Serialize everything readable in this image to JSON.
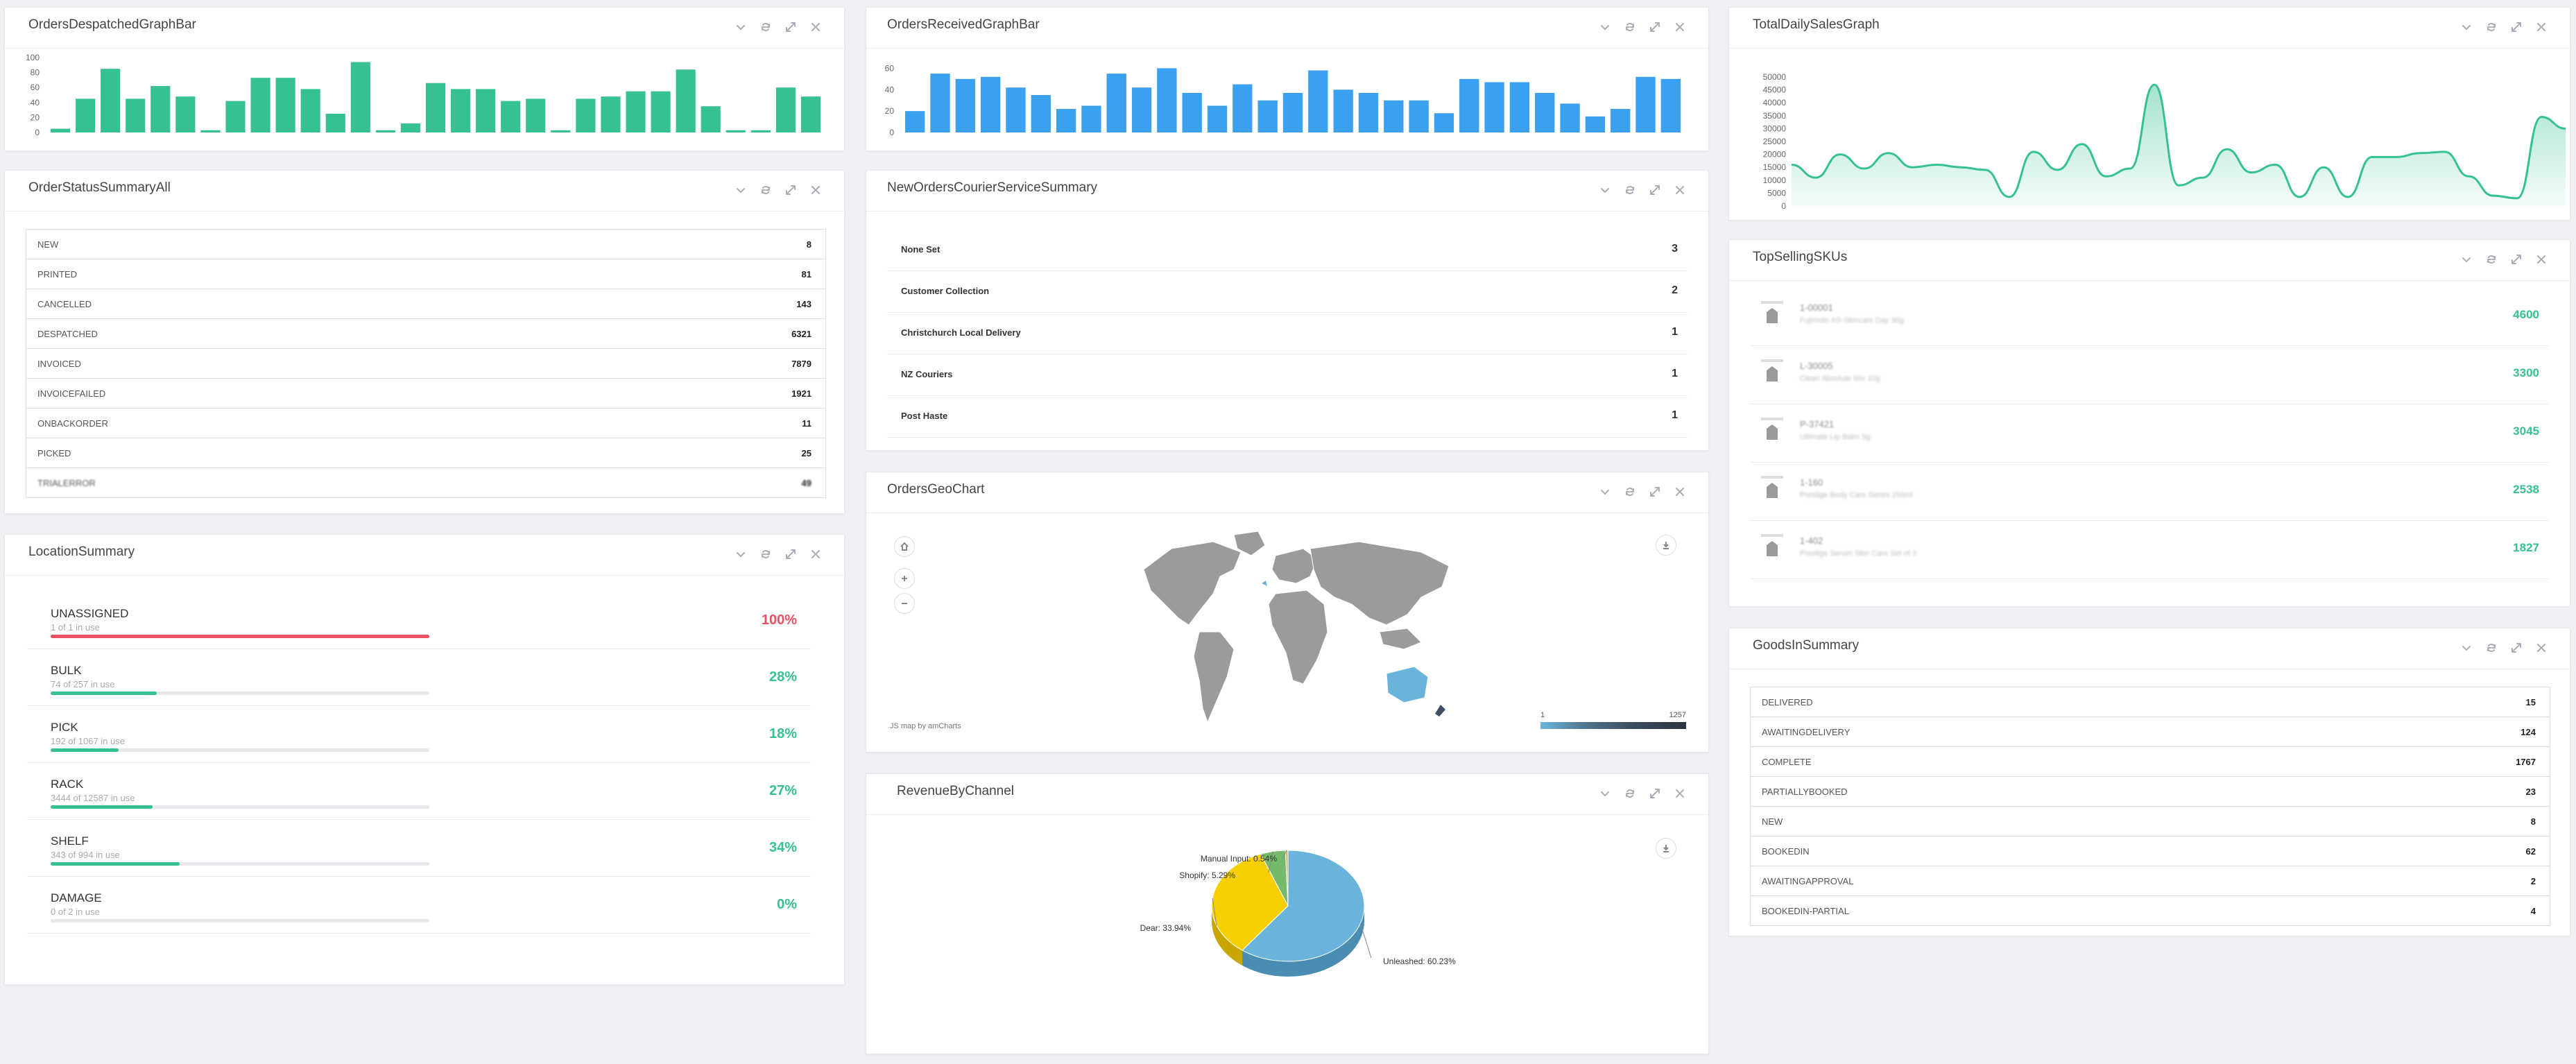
{
  "colors": {
    "teal": "#36c190",
    "blue": "#3aa0f0",
    "red": "#e8515f",
    "yellow": "#f8d000",
    "pieBlue": "#6ab4dc",
    "pieGreen": "#75b96b",
    "muted": "#9aa0aa"
  },
  "tool_icons": [
    "collapse-icon",
    "refresh-icon",
    "expand-icon",
    "close-icon"
  ],
  "despatched": {
    "title": "OrdersDespatchedGraphBar",
    "chart_data": {
      "type": "bar",
      "values": [
        5,
        45,
        85,
        45,
        62,
        48,
        3,
        42,
        73,
        73,
        58,
        25,
        94,
        3,
        12,
        66,
        58,
        58,
        42,
        45,
        3,
        45,
        48,
        55,
        55,
        84,
        35,
        3,
        3,
        60,
        48
      ],
      "ylim": [
        0,
        100
      ],
      "yticks": [
        "0",
        "20",
        "40",
        "60",
        "80",
        "100"
      ]
    }
  },
  "received": {
    "title": "OrdersReceivedGraphBar",
    "chart_data": {
      "type": "bar",
      "values": [
        20,
        55,
        50,
        52,
        42,
        35,
        22,
        25,
        55,
        42,
        60,
        37,
        25,
        45,
        30,
        37,
        58,
        40,
        37,
        30,
        30,
        18,
        50,
        47,
        47,
        37,
        27,
        15,
        22,
        52,
        50
      ],
      "ylim": [
        0,
        70
      ],
      "yticks": [
        "0",
        "20",
        "40",
        "60"
      ]
    }
  },
  "sales": {
    "title": "TotalDailySalesGraph",
    "chart_data": {
      "type": "area",
      "values": [
        16000,
        11000,
        20000,
        14500,
        20500,
        15000,
        16000,
        15000,
        14000,
        3500,
        21000,
        14000,
        24000,
        11500,
        14500,
        47000,
        8000,
        11000,
        22000,
        13000,
        16000,
        3500,
        15000,
        3500,
        19000,
        19000,
        20500,
        21000,
        11500,
        4000,
        3000,
        34500,
        30000
      ],
      "ylim": [
        0,
        50000
      ],
      "yticks": [
        "0",
        "5000",
        "10000",
        "15000",
        "20000",
        "25000",
        "30000",
        "35000",
        "40000",
        "45000",
        "50000"
      ]
    }
  },
  "orderStatus": {
    "title": "OrderStatusSummaryAll",
    "rows": [
      {
        "label": "NEW",
        "value": "8"
      },
      {
        "label": "PRINTED",
        "value": "81"
      },
      {
        "label": "CANCELLED",
        "value": "143"
      },
      {
        "label": "DESPATCHED",
        "value": "6321"
      },
      {
        "label": "INVOICED",
        "value": "7879"
      },
      {
        "label": "INVOICEFAILED",
        "value": "1921"
      },
      {
        "label": "ONBACKORDER",
        "value": "11"
      },
      {
        "label": "PICKED",
        "value": "25"
      },
      {
        "label": "TRIALERROR",
        "value": "49"
      }
    ]
  },
  "courier": {
    "title": "NewOrdersCourierServiceSummary",
    "rows": [
      {
        "label": "None Set",
        "value": "3"
      },
      {
        "label": "Customer Collection",
        "value": "2"
      },
      {
        "label": "Christchurch Local Delivery",
        "value": "1"
      },
      {
        "label": "NZ Couriers",
        "value": "1"
      },
      {
        "label": "Post Haste",
        "value": "1"
      }
    ]
  },
  "topSkus": {
    "title": "TopSellingSKUs",
    "rows": [
      {
        "code": "1-00001",
        "desc": "Fujimoto AS-Skincare Day 30g",
        "value": "4600"
      },
      {
        "code": "L-30005",
        "desc": "Clean Absolute Mix 10g",
        "value": "3300"
      },
      {
        "code": "P-37421",
        "desc": "Ultimate Lip Balm 5g",
        "value": "3045"
      },
      {
        "code": "1-160",
        "desc": "Prestige Body Care Series 250ml",
        "value": "2538"
      },
      {
        "code": "1-402",
        "desc": "Prestige Serum Skin Care Set of 3",
        "value": "1827"
      }
    ]
  },
  "location": {
    "title": "LocationSummary",
    "rows": [
      {
        "name": "UNASSIGNED",
        "sub": "1 of 1 in use",
        "pct": "100%",
        "fill": 1.0,
        "color": "#e8515f"
      },
      {
        "name": "BULK",
        "sub": "74 of 257 in use",
        "pct": "28%",
        "fill": 0.28,
        "color": "#36c190"
      },
      {
        "name": "PICK",
        "sub": "192 of 1067 in use",
        "pct": "18%",
        "fill": 0.18,
        "color": "#36c190"
      },
      {
        "name": "RACK",
        "sub": "3444 of 12587 in use",
        "pct": "27%",
        "fill": 0.27,
        "color": "#36c190"
      },
      {
        "name": "SHELF",
        "sub": "343 of 994 in use",
        "pct": "34%",
        "fill": 0.34,
        "color": "#36c190"
      },
      {
        "name": "DAMAGE",
        "sub": "0 of 2 in use",
        "pct": "0%",
        "fill": 0.0,
        "color": "#36c190"
      }
    ]
  },
  "geo": {
    "title": "OrdersGeoChart",
    "credit": "JS map by amCharts",
    "legend_min": "1",
    "legend_max": "1257"
  },
  "revenue": {
    "title": "RevenueByChannel",
    "chart_data": {
      "type": "pie",
      "slices": [
        {
          "label": "Unleashed: 60.23%",
          "value": 60.23
        },
        {
          "label": "Dear: 33.94%",
          "value": 33.94
        },
        {
          "label": "Shopify: 5.29%",
          "value": 5.29
        },
        {
          "label": "Manual Input: 0.54%",
          "value": 0.54
        }
      ]
    }
  },
  "goodsIn": {
    "title": "GoodsInSummary",
    "rows": [
      {
        "label": "DELIVERED",
        "value": "15"
      },
      {
        "label": "AWAITINGDELIVERY",
        "value": "124"
      },
      {
        "label": "COMPLETE",
        "value": "1767"
      },
      {
        "label": "PARTIALLYBOOKED",
        "value": "23"
      },
      {
        "label": "NEW",
        "value": "8"
      },
      {
        "label": "BOOKEDIN",
        "value": "62"
      },
      {
        "label": "AWAITINGAPPROVAL",
        "value": "2"
      },
      {
        "label": "BOOKEDIN-PARTIAL",
        "value": "4"
      }
    ]
  }
}
